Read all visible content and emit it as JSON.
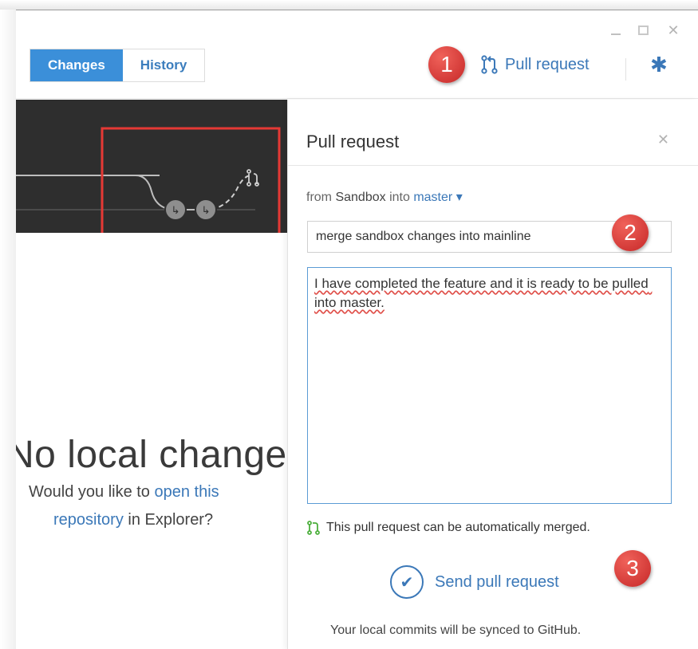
{
  "tabs": [
    {
      "label": "Changes",
      "active": true
    },
    {
      "label": "History",
      "active": false
    }
  ],
  "toolbar": {
    "pull_request_label": "Pull request"
  },
  "panel": {
    "title": "Pull request",
    "branch": {
      "prefix": "from",
      "source": "Sandbox",
      "middle": "into",
      "target": "master",
      "dropdown_glyph": "▾"
    },
    "title_value": "merge sandbox changes into mainline",
    "body_value": "I have completed the feature and it is ready to be pulled into master.",
    "merge_status": "This pull request can be automatically merged.",
    "send_label": "Send pull request",
    "sync_note": "Your local commits will be synced to GitHub."
  },
  "empty_state": {
    "heading": "No local changes",
    "line1_prefix": "Would you like to",
    "line1_link": "open this",
    "line2_link": "repository",
    "line2_suffix": "in Explorer?"
  },
  "callouts": [
    "1",
    "2",
    "3"
  ],
  "colors": {
    "accent": "#3b8fd9",
    "link": "#3b78b8",
    "callout": "#d9342b",
    "merge_ok": "#4caf3c",
    "highlight_box": "#e53935"
  },
  "icons": {
    "pull_request": "pull-request-icon",
    "settings": "gear-icon",
    "close": "close-icon",
    "check": "check-icon"
  }
}
